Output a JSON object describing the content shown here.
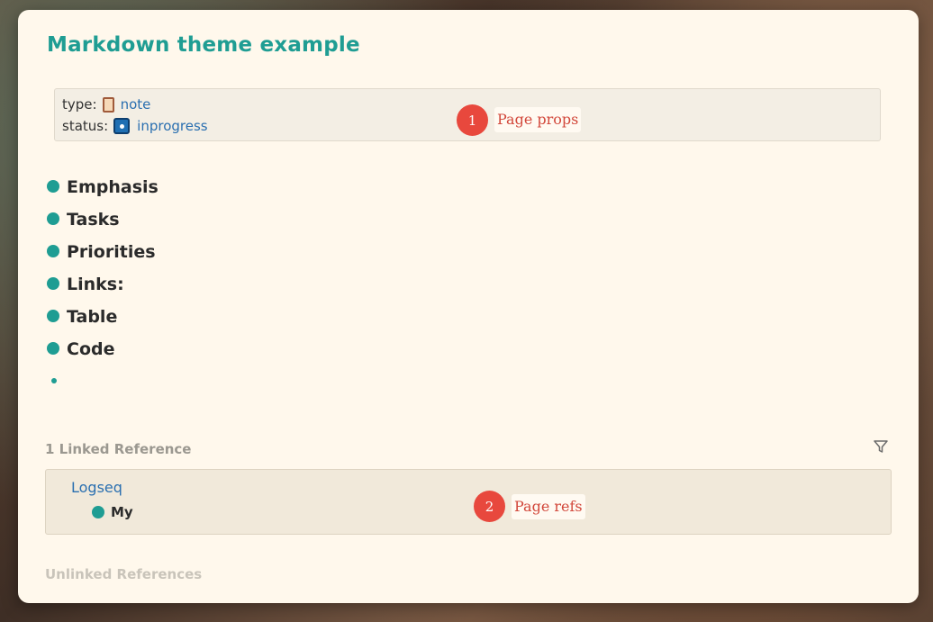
{
  "page": {
    "title": "Markdown theme example"
  },
  "properties": [
    {
      "key": "type:",
      "value": "note",
      "icon": "note-icon"
    },
    {
      "key": "status:",
      "value": "inprogress",
      "icon": "status-inprogress-icon"
    }
  ],
  "annotations": [
    {
      "number": "1",
      "label": "Page props"
    },
    {
      "number": "2",
      "label": "Page refs"
    }
  ],
  "blocks": [
    {
      "text": "Emphasis"
    },
    {
      "text": "Tasks"
    },
    {
      "text": "Priorities"
    },
    {
      "text": "Links:"
    },
    {
      "text": "Table"
    },
    {
      "text": "Code"
    }
  ],
  "references": {
    "linked_heading": "1 Linked Reference",
    "linked": [
      {
        "page": "Logseq",
        "block": "My"
      }
    ],
    "unlinked_heading": "Unlinked References",
    "filter_icon": "filter-icon"
  },
  "colors": {
    "accent": "#1f9d93",
    "link": "#2a6fb0",
    "annotation": "#e8483d",
    "background": "#fff8ec"
  }
}
